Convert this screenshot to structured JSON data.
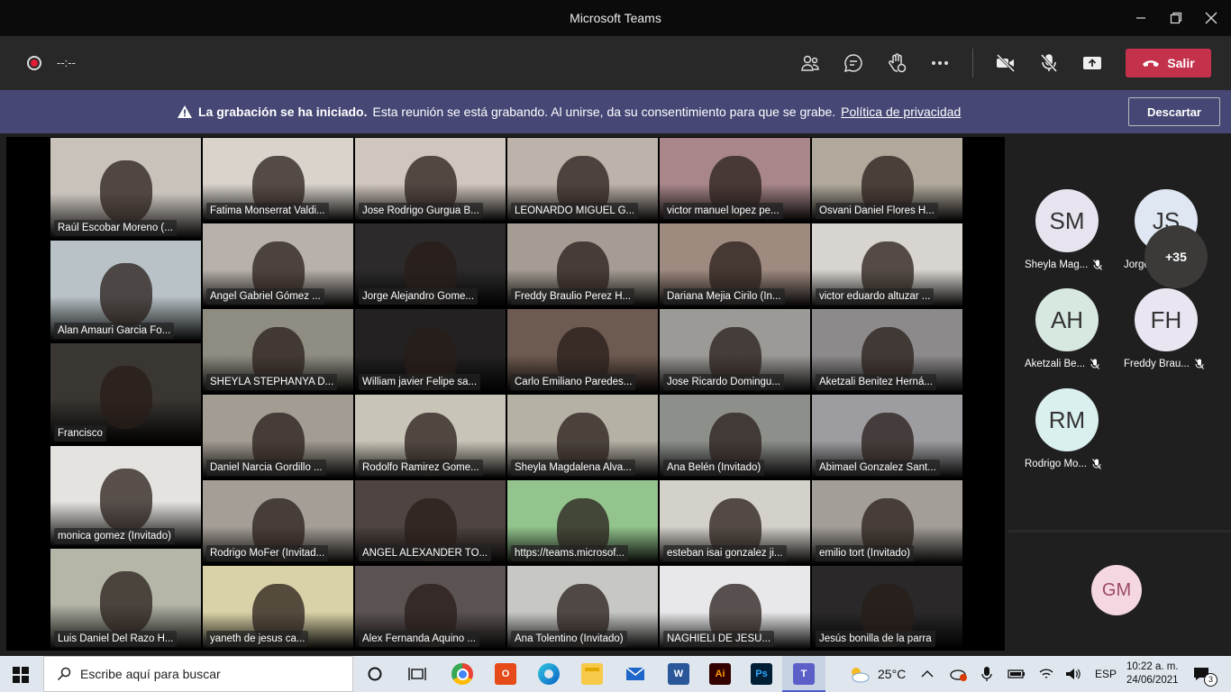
{
  "window": {
    "title": "Microsoft Teams"
  },
  "toolbar": {
    "timer": "--:--",
    "leave_label": "Salir"
  },
  "banner": {
    "bold": "La grabación se ha iniciado.",
    "message": "Esta reunión se está grabando. Al unirse, da su consentimiento para que se grabe.",
    "link": "Política de privacidad",
    "dismiss": "Descartar"
  },
  "tiles": [
    {
      "name": "Raúl Escobar Moreno (...",
      "bg": "#c8c2bb"
    },
    {
      "name": "Fatima Monserrat Valdi...",
      "bg": "#d9d3cc"
    },
    {
      "name": "Jose Rodrigo Gurgua B...",
      "bg": "#cfc6bd"
    },
    {
      "name": "LEONARDO MIGUEL G...",
      "bg": "#bdb3aa"
    },
    {
      "name": "victor manuel lopez pe...",
      "bg": "#a8868a"
    },
    {
      "name": "Osvani Daniel Flores H...",
      "bg": "#b0a99c"
    },
    {
      "name": "Angel Gabriel Gómez ...",
      "bg": "#b8b1ab"
    },
    {
      "name": "Jorge Alejandro Gome...",
      "bg": "#2c2a2a"
    },
    {
      "name": "Freddy Braulio Perez H...",
      "bg": "#a59d94"
    },
    {
      "name": "Dariana Mejia Cirilo (In...",
      "bg": "#9f8a80"
    },
    {
      "name": "victor eduardo altuzar ...",
      "bg": "#d8d4cf"
    },
    {
      "name": "Alan Amauri Garcia Fo...",
      "bg": "#b9c3c7"
    },
    {
      "name": "SHEYLA STEPHANYA D...",
      "bg": "#8f8d82"
    },
    {
      "name": "William javier Felipe sa...",
      "bg": "#232121"
    },
    {
      "name": "Carlo Emiliano Paredes...",
      "bg": "#6d5a50"
    },
    {
      "name": "Jose Ricardo Domingu...",
      "bg": "#9c9a96"
    },
    {
      "name": "Aketzali Benitez Herná...",
      "bg": "#8d8a8c"
    },
    {
      "name": "Francisco",
      "bg": "#3a3632"
    },
    {
      "name": "Daniel Narcia Gordillo ...",
      "bg": "#a39c92"
    },
    {
      "name": "Rodolfo Ramirez Gome...",
      "bg": "#c9c4b8"
    },
    {
      "name": "Sheyla Magdalena Alva...",
      "bg": "#b5b1a5"
    },
    {
      "name": "Ana Belén (Invitado)",
      "bg": "#8c8f8a"
    },
    {
      "name": "Abimael Gonzalez Sant...",
      "bg": "#9d9da1"
    },
    {
      "name": "monica gomez (Invitado)",
      "bg": "#e5e3e0"
    },
    {
      "name": "Rodrigo MoFer (Invitad...",
      "bg": "#a49e96"
    },
    {
      "name": "ANGEL ALEXANDER TO...",
      "bg": "#4e4441"
    },
    {
      "name": "https://teams.microsof...",
      "bg": "#93c48e"
    },
    {
      "name": "esteban isai gonzalez ji...",
      "bg": "#d4d0ca"
    },
    {
      "name": "emilio tort (Invitado)",
      "bg": "#a39e98"
    },
    {
      "name": "Luis Daniel Del Razo H...",
      "bg": "#b5b6a8"
    },
    {
      "name": "yaneth de jesus ca...",
      "bg": "#d9d2a8"
    },
    {
      "name": "Alex Fernanda Aquino ...",
      "bg": "#5b5252"
    },
    {
      "name": "Ana Tolentino (Invitado)",
      "bg": "#c7c7c4"
    },
    {
      "name": "NAGHIELI DE JESU...",
      "bg": "#e8e8ea"
    },
    {
      "name": "Jesús bonilla de la parra",
      "bg": "#2a2828"
    }
  ],
  "participants": [
    {
      "initials": "SM",
      "name": "Sheyla Mag...",
      "color": "#e7e4ef"
    },
    {
      "initials": "JS",
      "name": "Jorge Aleja...",
      "color": "#dfe7f2"
    },
    {
      "initials": "AH",
      "name": "Aketzali Be...",
      "color": "#d7e8e0"
    },
    {
      "initials": "FH",
      "name": "Freddy Brau...",
      "color": "#e9e5f1"
    },
    {
      "initials": "RM",
      "name": "Rodrigo Mo...",
      "color": "#daf0ef"
    }
  ],
  "overflow": "+35",
  "self_avatar": {
    "initials": "GM",
    "color": "#f4d7e0"
  },
  "taskbar": {
    "search_placeholder": "Escribe aquí para buscar",
    "weather": "25°C",
    "lang": "ESP",
    "time": "10:22 a. m.",
    "date": "24/06/2021",
    "notifications": "3"
  }
}
